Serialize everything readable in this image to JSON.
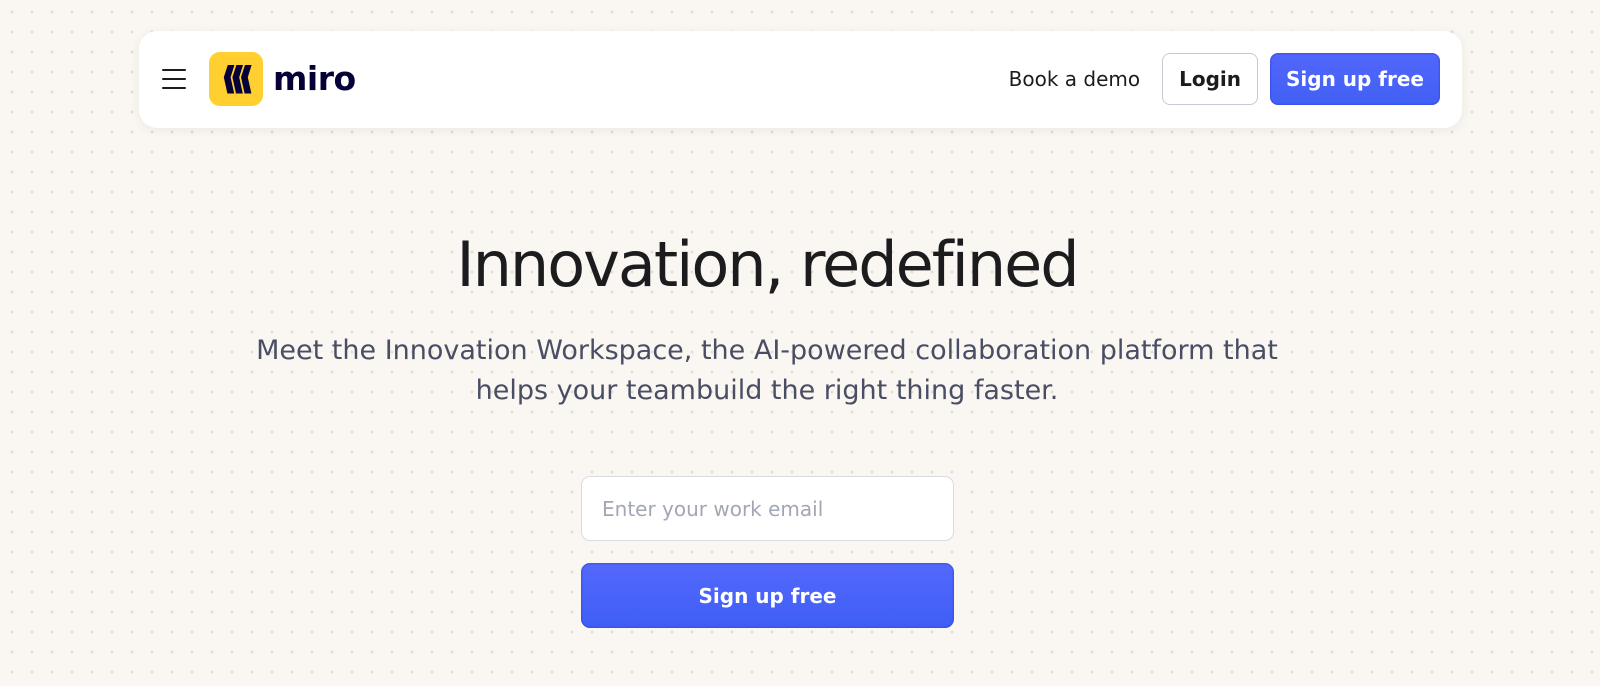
{
  "nav": {
    "menu_icon": "hamburger-menu-icon",
    "logo_text": "miro",
    "logo_color": "#ffd02f",
    "book_demo_label": "Book a demo",
    "login_label": "Login",
    "signup_label": "Sign up free"
  },
  "hero": {
    "title": "Innovation, redefined",
    "subtitle": "Meet the Innovation Workspace, the AI-powered collaboration platform that helps your teambuild the right thing faster.",
    "email_placeholder": "Enter your work email",
    "email_value": "",
    "signup_label": "Sign up free"
  },
  "colors": {
    "accent": "#4262ff",
    "background": "#faf7f2",
    "brand_yellow": "#ffd02f"
  }
}
